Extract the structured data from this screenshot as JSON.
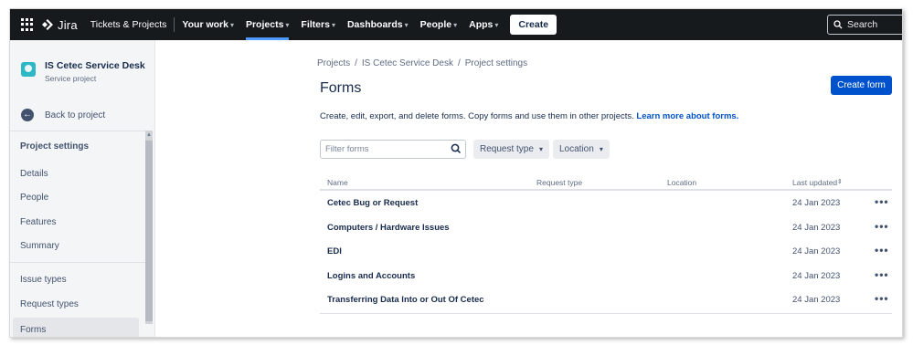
{
  "topbar": {
    "app_name": "Jira",
    "product": "Tickets & Projects",
    "nav": [
      {
        "label": "Your work",
        "chevron": "▾"
      },
      {
        "label": "Projects",
        "chevron": "▾"
      },
      {
        "label": "Filters",
        "chevron": "▾"
      },
      {
        "label": "Dashboards",
        "chevron": "▾"
      },
      {
        "label": "People",
        "chevron": "▾"
      },
      {
        "label": "Apps",
        "chevron": "▾"
      }
    ],
    "create_label": "Create",
    "search_placeholder": "Search",
    "accent": "#4c9aff"
  },
  "sidebar": {
    "project_name": "IS Cetec Service Desk",
    "project_type": "Service project",
    "back_label": "Back to project",
    "heading": "Project settings",
    "items": [
      {
        "label": "Details"
      },
      {
        "label": "People"
      },
      {
        "label": "Features"
      },
      {
        "label": "Summary"
      },
      {
        "label": "Issue types"
      },
      {
        "label": "Request types"
      },
      {
        "label": "Forms"
      }
    ]
  },
  "main": {
    "breadcrumbs": [
      "Projects",
      "/",
      "IS Cetec Service Desk",
      "/",
      "Project settings"
    ],
    "title": "Forms",
    "create_form_label": "Create form",
    "description": "Create, edit, export, and delete forms. Copy forms and use them in other projects.",
    "learn_more": "Learn more about forms.",
    "filter_placeholder": "Filter forms",
    "dropdowns": [
      "Request type",
      "Location"
    ],
    "columns": [
      "Name",
      "Request type",
      "Location",
      "Last updated"
    ],
    "rows": [
      {
        "name": "Cetec Bug or Request",
        "updated": "24 Jan 2023",
        "more": "•••"
      },
      {
        "name": "Computers / Hardware Issues",
        "updated": "24 Jan 2023",
        "more": "•••"
      },
      {
        "name": "EDI",
        "updated": "24 Jan 2023",
        "more": "•••"
      },
      {
        "name": "Logins and Accounts",
        "updated": "24 Jan 2023",
        "more": "•••"
      },
      {
        "name": "Transferring Data Into or Out Of Cetec",
        "updated": "24 Jan 2023",
        "more": "•••"
      }
    ],
    "brand_color": "#0052cc"
  }
}
